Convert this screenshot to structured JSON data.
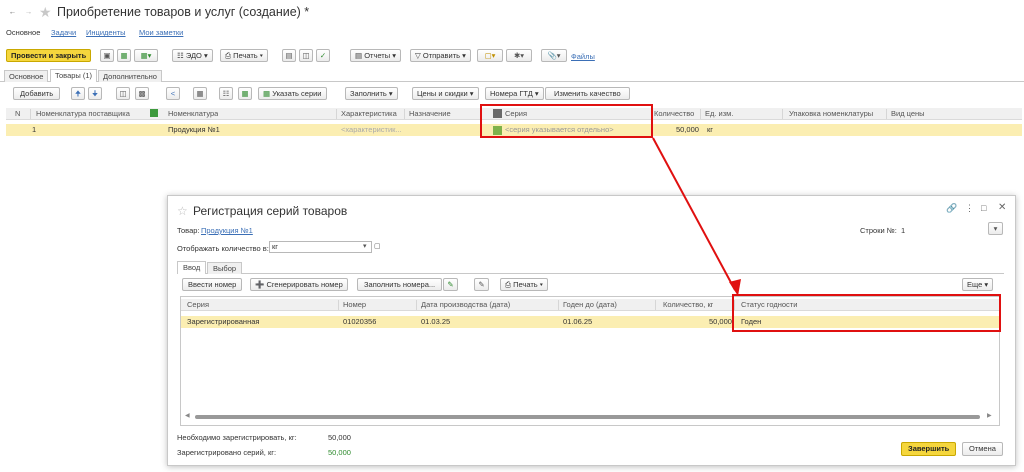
{
  "title": "Приобретение товаров и услуг (создание) *",
  "nav_tabs": [
    "Основное",
    "Задачи",
    "Инциденты",
    "Мои заметки"
  ],
  "toolbar": {
    "post_close": "Провести и закрыть",
    "edo": "ЭДО",
    "print": "Печать",
    "reports": "Отчеты",
    "send": "Отправить",
    "files": "Файлы"
  },
  "doc_tabs": [
    "Основное",
    "Товары (1)",
    "Дополнительно"
  ],
  "goods_toolbar": {
    "add": "Добавить",
    "set_series": "Указать серии",
    "fill": "Заполнить",
    "prices": "Цены и скидки",
    "gtd": "Номера ГТД",
    "quality": "Изменить качество"
  },
  "goods_table": {
    "headers": [
      "N",
      "Номенклатура поставщика",
      "Номенклатура",
      "Характеристика",
      "Назначение",
      "Серия",
      "Количество",
      "Ед. изм.",
      "Упаковка номенклатуры",
      "Вид цены"
    ],
    "row": {
      "n": "1",
      "item": "Продукция №1",
      "characteristic": "<характеристик...",
      "series": "<серия указывается отдельно>",
      "quantity": "50,000",
      "unit": "кг"
    }
  },
  "dialog": {
    "title": "Регистрация серий товаров",
    "product_label": "Товар:",
    "product": "Продукция №1",
    "rows_label": "Строки №:",
    "rows_value": "1",
    "display_label": "Отображать количество в:",
    "display_value": "кг",
    "tabs": [
      "Ввод",
      "Выбор"
    ],
    "toolbar": {
      "enter": "Ввести номер",
      "generate": "Сгенерировать номер",
      "fill": "Заполнить номера...",
      "print": "Печать",
      "more": "Еще"
    },
    "headers": [
      "Серия",
      "Номер",
      "Дата производства (дата)",
      "Годен до (дата)",
      "Количество, кг",
      "Статус годности"
    ],
    "row": {
      "series": "Зарегистрированная",
      "number": "01020356",
      "prod_date": "01.03.25",
      "exp_date": "01.06.25",
      "quantity": "50,000",
      "status": "Годен"
    },
    "need_label": "Необходимо зарегистрировать, кг:",
    "need_value": "50,000",
    "done_label": "Зарегистрировано серий, кг:",
    "done_value": "50,000",
    "finish": "Завершить",
    "cancel": "Отмена"
  },
  "colors": {
    "accent": "#f5d63d",
    "highlight": "#fbeeb2",
    "annotation": "#e01010",
    "link": "#3b6fb6",
    "green": "#2e8b2e"
  }
}
